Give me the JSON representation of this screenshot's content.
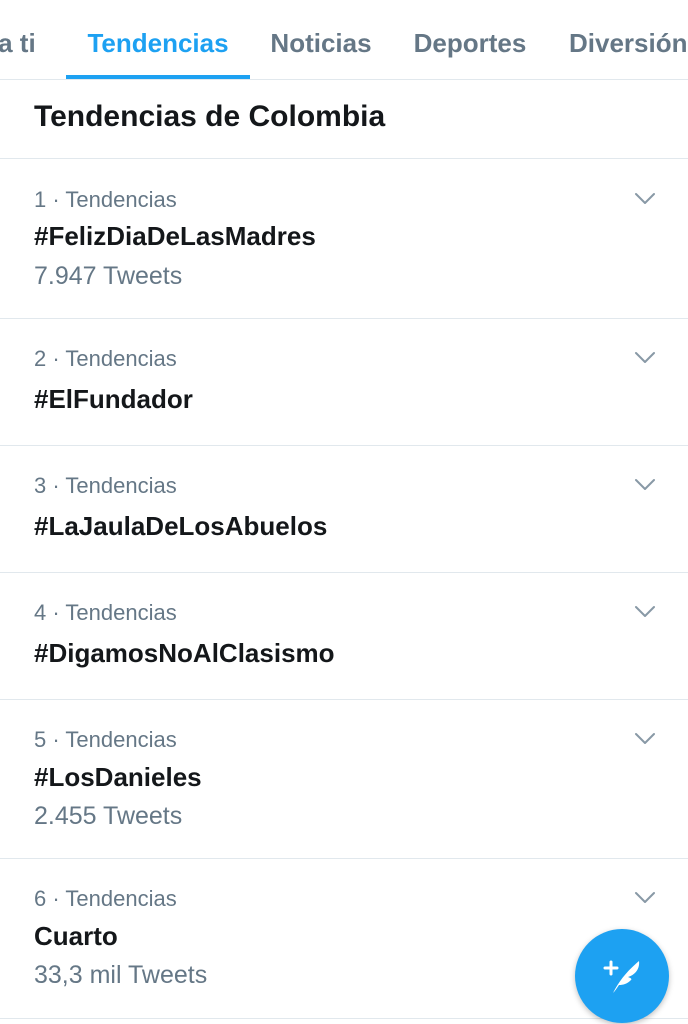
{
  "tabs": [
    {
      "label": "ra ti"
    },
    {
      "label": "Tendencias",
      "active": true
    },
    {
      "label": "Noticias"
    },
    {
      "label": "Deportes"
    },
    {
      "label": "Diversión"
    }
  ],
  "section": {
    "title": "Tendencias de Colombia"
  },
  "trends": [
    {
      "meta": "1 · Tendencias",
      "name": "#FelizDiaDeLasMadres",
      "count": "7.947 Tweets"
    },
    {
      "meta": "2 · Tendencias",
      "name": "#ElFundador"
    },
    {
      "meta": "3 · Tendencias",
      "name": "#LaJaulaDeLosAbuelos"
    },
    {
      "meta": "4 · Tendencias",
      "name": "#DigamosNoAlClasismo"
    },
    {
      "meta": "5 · Tendencias",
      "name": "#LosDanieles",
      "count": "2.455 Tweets"
    },
    {
      "meta": "6 · Tendencias",
      "name": "Cuarto",
      "count": "33,3 mil Tweets"
    }
  ],
  "icons": {
    "chevron": "chevron-down-icon",
    "compose": "compose-tweet-icon"
  },
  "colors": {
    "accent": "#1da1f2",
    "primary_text": "#14171a",
    "secondary_text": "#657786",
    "divider": "#e1e8ed"
  }
}
